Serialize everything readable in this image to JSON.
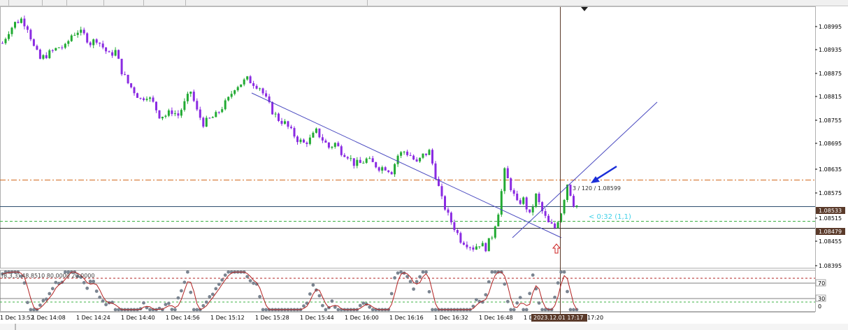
{
  "window": {
    "top_toolbar": "chart-window-toolbar"
  },
  "price_axis": {
    "labels": [
      "1.08995",
      "1.08935",
      "1.08875",
      "1.08815",
      "1.08755",
      "1.08695",
      "1.08635",
      "1.08575",
      "1.08515",
      "1.08455",
      "1.08395"
    ],
    "bid_tag": "1.08533",
    "line_tag": "1.08479"
  },
  "time_axis": {
    "labels": [
      "1 Dec 13:52",
      "1 Dec 14:08",
      "1 Dec 14:24",
      "1 Dec 14:40",
      "1 Dec 14:56",
      "1 Dec 15:12",
      "1 Dec 15:28",
      "1 Dec 15:44",
      "1 Dec 16:00",
      "1 Dec 16:16",
      "1 Dec 16:32",
      "1 Dec 16:48",
      "1 D",
      "17:20"
    ],
    "crosshair_time": "2023.12.01 17:17"
  },
  "annotations": {
    "crosshair_readout": "3 / 120 / 1.08599",
    "bar_timer": "< 0:32 (1,1)"
  },
  "indicator": {
    "params": "(8,3,3) 48.8510 80.0000 20.0000",
    "levels": [
      "70",
      "30",
      "0"
    ]
  },
  "colors": {
    "bull_candle": "#22aa33",
    "bear_candle": "#8a2be2",
    "trendline": "#4a4ac0",
    "dashdot_level": "#d2691e",
    "green_dashed": "#3cb043",
    "bid_line": "#2f4f6f",
    "price_tag_bg": "#5a3a2a",
    "arrow_blue": "#1a2ed8",
    "arrow_red": "#cc2222",
    "crosshair": "#5a3a2a",
    "stoch_dots": "#7a8490",
    "signal_line": "#b22222",
    "timer_text": "#3fd0e8"
  },
  "chart_data": {
    "type": "candlestick",
    "symbol_timeframe": "",
    "ylim": [
      1.0838,
      1.0903
    ],
    "y_ticks": [
      1.08995,
      1.08935,
      1.08875,
      1.08815,
      1.08755,
      1.08695,
      1.08635,
      1.08575,
      1.08515,
      1.08455,
      1.08395
    ],
    "levels": {
      "dashdot": 1.086,
      "bid": 1.08533,
      "horizontal": 1.08479,
      "green_dashed": 1.08497
    },
    "trendline_down": [
      [
        0.0,
        1.0863
      ],
      [
        0.08,
        1.08593
      ],
      [
        0.16,
        1.08562
      ],
      [
        0.24,
        1.08535
      ],
      [
        0.32,
        1.08512
      ]
    ],
    "close_path": [
      1.0894,
      1.0897,
      1.0899,
      1.09,
      1.0898,
      1.0893,
      1.089,
      1.0891,
      1.0892,
      1.0893,
      1.0893,
      1.0896,
      1.0897,
      1.0896,
      1.0894,
      1.0895,
      1.0893,
      1.0891,
      1.0892,
      1.0887,
      1.0884,
      1.0882,
      1.088,
      1.0881,
      1.0879,
      1.0876,
      1.0876,
      1.0877,
      1.0876,
      1.0879,
      1.0882,
      1.0877,
      1.0874,
      1.0875,
      1.0876,
      1.0878,
      1.088,
      1.0883,
      1.0884,
      1.0885,
      1.0884,
      1.0883,
      1.088,
      1.0877,
      1.0875,
      1.0874,
      1.0872,
      1.087,
      1.0869,
      1.087,
      1.0872,
      1.087,
      1.0868,
      1.0869,
      1.0867,
      1.0866,
      1.0864,
      1.0864,
      1.0865,
      1.0864,
      1.0863,
      1.0863,
      1.0862,
      1.0866,
      1.0867,
      1.0866,
      1.0864,
      1.0866,
      1.0867,
      1.0861,
      1.0855,
      1.0851,
      1.0848,
      1.0845,
      1.0844,
      1.0843,
      1.0844,
      1.0843,
      1.0846,
      1.0852,
      1.0862,
      1.0858,
      1.0854,
      1.0855,
      1.0851,
      1.0856,
      1.0852,
      1.0849,
      1.0848,
      1.0852,
      1.0859,
      1.0854,
      1.0853
    ]
  }
}
